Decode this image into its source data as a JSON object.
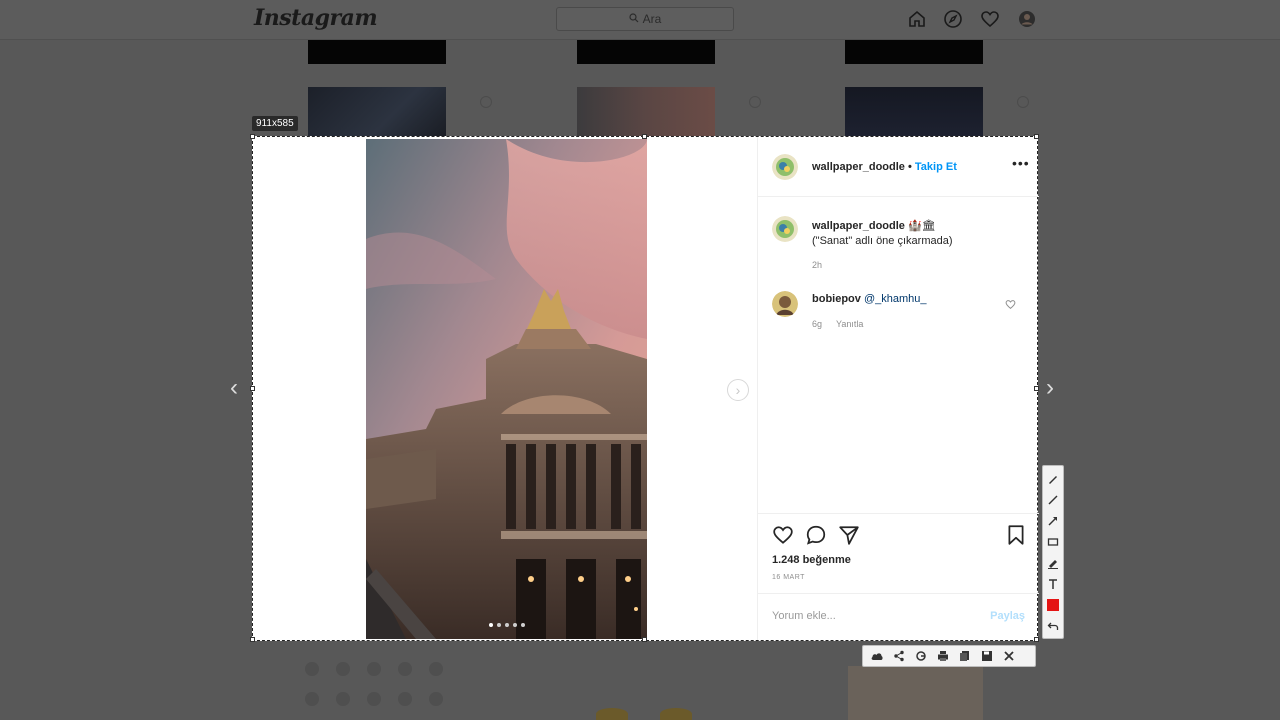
{
  "header": {
    "logo": "Instagram",
    "search_placeholder": "Ara"
  },
  "capture": {
    "size_label": "911x585"
  },
  "post": {
    "author": "wallpaper_doodle",
    "separator": "•",
    "follow_label": "Takip Et",
    "more_label": "•••",
    "caption_author": "wallpaper_doodle",
    "caption_emoji": "🏰🏛",
    "caption_text": "(\"Sanat\" adlı öne çıkarmada)",
    "caption_time": "2h",
    "comment_author": "bobiepov",
    "comment_mention": "@_khamhu_",
    "comment_time": "6g",
    "comment_reply": "Yanıtla",
    "likes": "1.248 beğenme",
    "date": "16 MART",
    "comment_placeholder": "Yorum ekle...",
    "share_label": "Paylaş"
  },
  "icons": {
    "home": "home-icon",
    "explore": "compass-icon",
    "activity": "heart-icon",
    "profile": "avatar-icon"
  },
  "colors": {
    "accent": "#0095f6",
    "toolbar_red": "#e41414",
    "dim_bg": "#585858"
  }
}
